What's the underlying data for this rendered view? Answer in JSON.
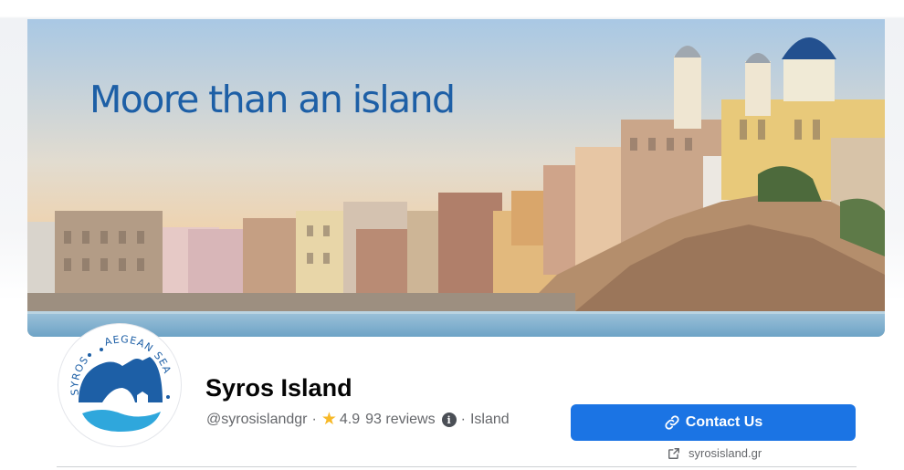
{
  "cover": {
    "headline": "Moore than an island"
  },
  "profile": {
    "logo_text_left": "SYROS",
    "logo_text_right": "AEGEAN SEA",
    "name": "Syros Island",
    "handle": "@syrosislandgr",
    "rating": "4.9",
    "reviews": "93 reviews",
    "category": "Island"
  },
  "actions": {
    "contact_label": "Contact Us",
    "website": "syrosisland.gr"
  },
  "icons": {
    "rating": "star-icon",
    "info": "info-icon",
    "contact": "link-icon",
    "website": "external-link-icon"
  },
  "colors": {
    "primary_button": "#1b74e4",
    "headline": "#1d5fa6",
    "star": "#f7b928",
    "secondary_text": "#65676b"
  }
}
